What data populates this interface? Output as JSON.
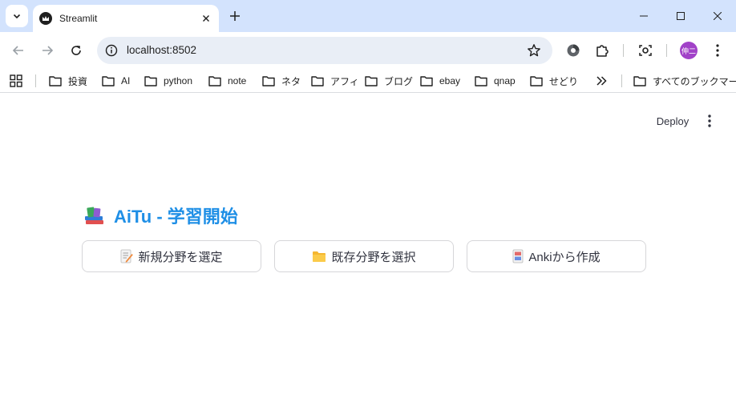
{
  "browser": {
    "tab_title": "Streamlit",
    "url": "localhost:8502",
    "profile_label": "伸二",
    "bookmarks": [
      "投資",
      "AI",
      "python",
      "note",
      "ネタ",
      "アフィ",
      "ブログ",
      "ebay",
      "qnap",
      "せどり"
    ],
    "all_bookmarks": "すべてのブックマーク"
  },
  "app": {
    "deploy_label": "Deploy",
    "title": "AiTu - 学習開始",
    "buttons": [
      {
        "label": "新規分野を選定",
        "icon": "memo-icon"
      },
      {
        "label": "既存分野を選択",
        "icon": "folder-icon"
      },
      {
        "label": "Ankiから作成",
        "icon": "card-icon"
      }
    ]
  },
  "colors": {
    "title_blue": "#1f8fe6",
    "tab_strip": "#d3e3fd",
    "omnibox": "#e9eef6",
    "profile": "#a142c8"
  }
}
